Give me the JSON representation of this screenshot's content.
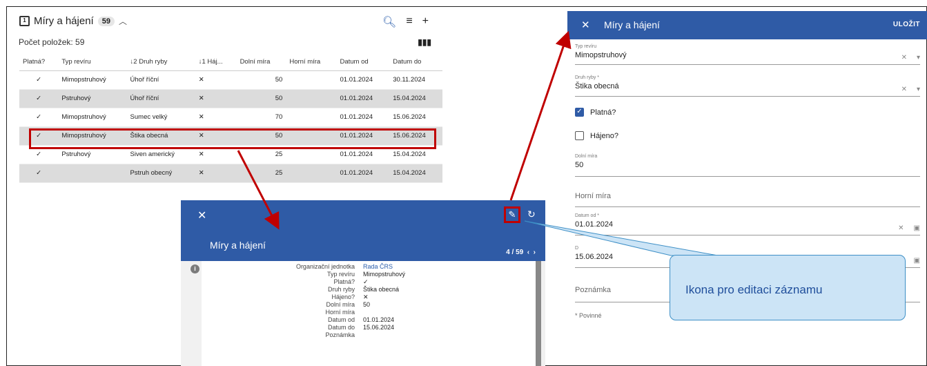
{
  "table": {
    "title": "Míry a hájení",
    "count_badge": "59",
    "count_label": "Počet položek: 59",
    "headers": [
      "Platná?",
      "Typ revíru",
      "↓2 Druh ryby",
      "↓1 Háj...",
      "Dolní míra",
      "Horní míra",
      "Datum od",
      "Datum do"
    ],
    "rows": [
      {
        "platna": "✓",
        "typ": "Mimopstruhový",
        "druh": "Úhoř říční",
        "hajeno": "✕",
        "dolni": "50",
        "horni": "",
        "od": "01.01.2024",
        "do": "30.11.2024"
      },
      {
        "platna": "✓",
        "typ": "Pstruhový",
        "druh": "Úhoř říční",
        "hajeno": "✕",
        "dolni": "50",
        "horni": "",
        "od": "01.01.2024",
        "do": "15.04.2024"
      },
      {
        "platna": "✓",
        "typ": "Mimopstruhový",
        "druh": "Sumec velký",
        "hajeno": "✕",
        "dolni": "70",
        "horni": "",
        "od": "01.01.2024",
        "do": "15.06.2024"
      },
      {
        "platna": "✓",
        "typ": "Mimopstruhový",
        "druh": "Štika obecná",
        "hajeno": "✕",
        "dolni": "50",
        "horni": "",
        "od": "01.01.2024",
        "do": "15.06.2024"
      },
      {
        "platna": "✓",
        "typ": "Pstruhový",
        "druh": "Siven americký",
        "hajeno": "✕",
        "dolni": "25",
        "horni": "",
        "od": "01.01.2024",
        "do": "15.04.2024"
      },
      {
        "platna": "✓",
        "typ": "",
        "druh": "Pstruh obecný",
        "hajeno": "✕",
        "dolni": "25",
        "horni": "",
        "od": "01.01.2024",
        "do": "15.04.2024"
      }
    ]
  },
  "detail": {
    "title": "Míry a hájení",
    "pager": "4 / 59",
    "fields": [
      {
        "label": "Organizační jednotka",
        "value": "Rada ČRS"
      },
      {
        "label": "Typ revíru",
        "value": "Mimopstruhový"
      },
      {
        "label": "Platná?",
        "value": "✓"
      },
      {
        "label": "Druh ryby",
        "value": "Štika obecná"
      },
      {
        "label": "Hájeno?",
        "value": "✕"
      },
      {
        "label": "Dolní míra",
        "value": "50"
      },
      {
        "label": "Horní míra",
        "value": ""
      },
      {
        "label": "Datum od",
        "value": "01.01.2024"
      },
      {
        "label": "Datum do",
        "value": "15.06.2024"
      },
      {
        "label": "Poznámka",
        "value": ""
      }
    ]
  },
  "form": {
    "title": "Míry a hájení",
    "save_label": "ULOŽIT",
    "typ_reviru_label": "Typ revíru",
    "typ_reviru_value": "Mimopstruhový",
    "druh_ryby_label": "Druh ryby *",
    "druh_ryby_value": "Štika obecná",
    "platna_label": "Platná?",
    "hajeno_label": "Hájeno?",
    "dolni_mira_label": "Dolní míra",
    "dolni_mira_value": "50",
    "horni_mira_placeholder": "Horní míra",
    "datum_od_label": "Datum od *",
    "datum_od_value": "01.01.2024",
    "datum_do_label": "D",
    "datum_do_value": "15.06.2024",
    "poznamka_placeholder": "Poznámka",
    "required_note": "* Povinné"
  },
  "callout": {
    "text": "Ikona pro editaci záznamu"
  },
  "colors": {
    "header_blue": "#2f5ba6",
    "highlight_red": "#c00000",
    "callout_fill": "#cce4f6"
  }
}
